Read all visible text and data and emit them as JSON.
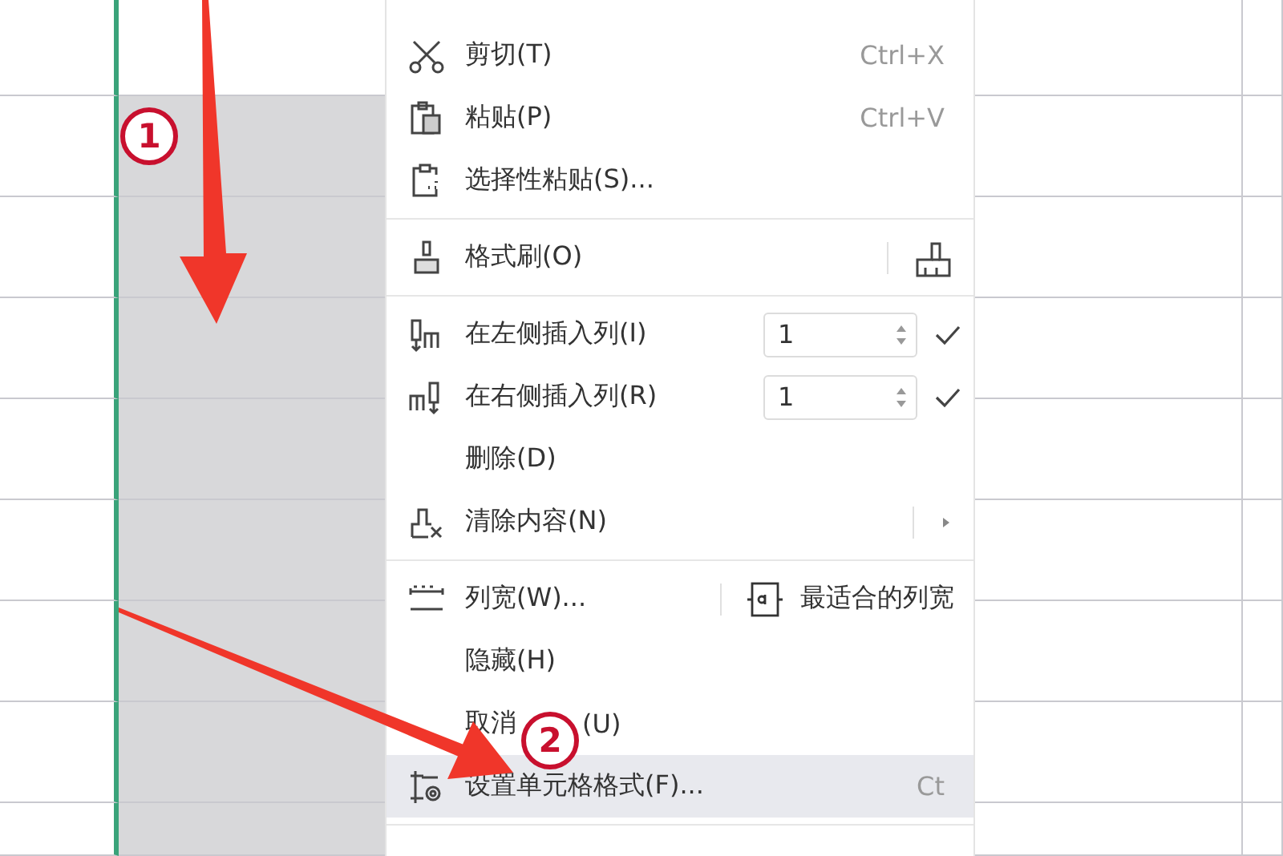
{
  "sheet": {
    "columns": [
      {
        "selected": false
      },
      {
        "selected": true
      },
      {
        "selected": false
      },
      {
        "selected": false
      }
    ],
    "rows": [
      {
        "selected": false
      },
      {
        "selected": true
      },
      {
        "selected": true
      },
      {
        "selected": true
      },
      {
        "selected": true
      },
      {
        "selected": true
      },
      {
        "selected": true
      },
      {
        "selected": true
      },
      {
        "selected": true
      }
    ]
  },
  "context_menu": {
    "items": [
      {
        "kind": "item",
        "label": "剪切(T)",
        "shortcut": "Ctrl+X",
        "selected": false
      },
      {
        "kind": "item",
        "label": "粘贴(P)",
        "shortcut": "Ctrl+V",
        "selected": false
      },
      {
        "kind": "item",
        "label": "选择性粘贴(S)...",
        "selected": false
      },
      {
        "kind": "separator"
      },
      {
        "kind": "split",
        "label": "格式刷(O)",
        "selected": false
      },
      {
        "kind": "separator"
      },
      {
        "kind": "spinner",
        "label": "在左侧插入列(I)",
        "value": "1",
        "selected": false
      },
      {
        "kind": "spinner",
        "label": "在右侧插入列(R)",
        "value": "1",
        "selected": false
      },
      {
        "kind": "item",
        "label": "删除(D)",
        "selected": false
      },
      {
        "kind": "item",
        "label": "清除内容(N)",
        "submenu": true,
        "selected": false
      },
      {
        "kind": "separator"
      },
      {
        "kind": "split",
        "label": "列宽(W)...",
        "side_label": "最适合的列宽",
        "selected": false
      },
      {
        "kind": "item",
        "label": "隐藏(H)",
        "selected": false
      },
      {
        "kind": "item",
        "label": "取消",
        "label_tail": "(U)",
        "selected": false
      },
      {
        "kind": "item",
        "label": "设置单元格格式(F)...",
        "shortcut": "Ct",
        "selected": true
      },
      {
        "kind": "separator"
      }
    ]
  },
  "annotations": [
    {
      "label": "1"
    },
    {
      "label": "2"
    }
  ]
}
